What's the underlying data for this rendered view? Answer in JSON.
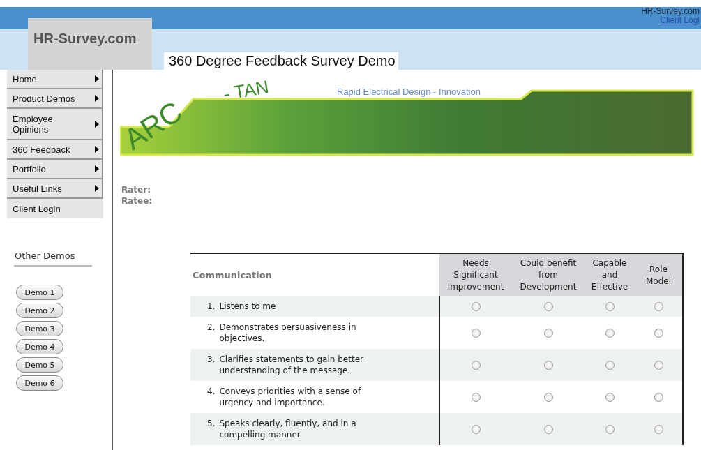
{
  "header": {
    "logo": "HR-Survey.com",
    "site_name": "HR-Survey.com",
    "login_link": "Client Logi",
    "title": "360 Degree Feedback Survey Demo"
  },
  "menu": [
    {
      "label": "Home",
      "has_submenu": true
    },
    {
      "label": "Product Demos",
      "has_submenu": true
    },
    {
      "label": "Employee Opinions",
      "has_submenu": true
    },
    {
      "label": "360 Feedback",
      "has_submenu": true
    },
    {
      "label": "Portfolio",
      "has_submenu": true
    },
    {
      "label": "Useful Links",
      "has_submenu": true
    },
    {
      "label": "Client Login",
      "has_submenu": false
    }
  ],
  "other_demos": {
    "heading": "Other Demos",
    "buttons": [
      "Demo 1",
      "Demo 2",
      "Demo 3",
      "Demo 4",
      "Demo 5",
      "Demo 6"
    ]
  },
  "banner": {
    "logo_parts": [
      "ARC",
      "- TAN"
    ],
    "tagline": "Rapid Electrical Design - Innovation"
  },
  "fields": [
    "Rater:",
    "Ratee:"
  ],
  "survey": {
    "section": "Communication",
    "columns": [
      "Needs Significant Improvement",
      "Could benefit from Development",
      "Capable and Effective",
      "Role Model"
    ],
    "rows": [
      {
        "number": "1.",
        "text": "Listens to me",
        "choices": [
          {
            "selected": false
          },
          {
            "selected": false
          },
          {
            "selected": false
          },
          {
            "selected": false
          }
        ]
      },
      {
        "number": "2.",
        "text": "Demonstrates persuasiveness in objectives.",
        "choices": [
          {
            "selected": false
          },
          {
            "selected": false
          },
          {
            "selected": false
          },
          {
            "selected": false
          }
        ]
      },
      {
        "number": "3.",
        "text": "Clarifies statements to gain better understanding of the message.",
        "choices": [
          {
            "selected": false
          },
          {
            "selected": false
          },
          {
            "selected": false
          },
          {
            "selected": false
          }
        ]
      },
      {
        "number": "4.",
        "text": "Conveys priorities with a sense of urgency and importance.",
        "choices": [
          {
            "selected": false
          },
          {
            "selected": false
          },
          {
            "selected": false
          },
          {
            "selected": false
          }
        ]
      },
      {
        "number": "5.",
        "text": "Speaks clearly, fluently, and in a compelling manner.",
        "choices": [
          {
            "selected": false
          },
          {
            "selected": false
          },
          {
            "selected": false
          },
          {
            "selected": false
          }
        ]
      }
    ]
  }
}
